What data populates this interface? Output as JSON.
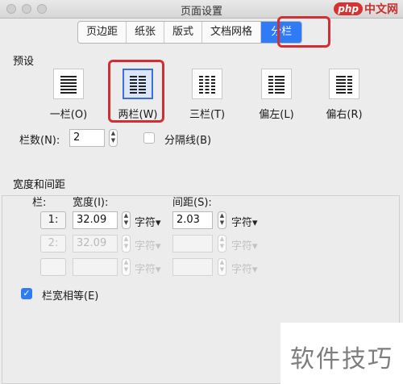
{
  "window": {
    "title": "页面设置"
  },
  "watermark": {
    "logo": "php",
    "text": "中文网",
    "bottom_text": "软件技巧"
  },
  "tabs": [
    {
      "label": "页边距"
    },
    {
      "label": "纸张"
    },
    {
      "label": "版式"
    },
    {
      "label": "文档网格"
    },
    {
      "label": "分栏",
      "active": true
    }
  ],
  "presets": {
    "heading": "预设",
    "items": [
      {
        "label": "一栏(O)",
        "icon": "one-column-icon"
      },
      {
        "label": "两栏(W)",
        "icon": "two-columns-icon",
        "selected": true
      },
      {
        "label": "三栏(T)",
        "icon": "three-columns-icon"
      },
      {
        "label": "偏左(L)",
        "icon": "left-column-icon"
      },
      {
        "label": "偏右(R)",
        "icon": "right-column-icon"
      }
    ]
  },
  "columns": {
    "label": "栏数(N):",
    "value": "2",
    "divider_label": "分隔线(B)",
    "divider_checked": false
  },
  "width_spacing": {
    "heading": "宽度和间距",
    "col_header": "栏:",
    "width_header": "宽度(I):",
    "spacing_header": "间距(S):",
    "rows": [
      {
        "col": "1:",
        "width": "32.09",
        "width_unit": "字符",
        "spacing": "2.03",
        "spacing_unit": "字符",
        "enabled": true
      },
      {
        "col": "2:",
        "width": "32.09",
        "width_unit": "字符",
        "spacing": "",
        "spacing_unit": "字符",
        "enabled": false
      },
      {
        "col": "",
        "width": "",
        "width_unit": "字符",
        "spacing": "",
        "spacing_unit": "字符",
        "enabled": false
      }
    ],
    "equal_width_label": "栏宽相等(E)",
    "equal_width_checked": true
  },
  "colors": {
    "accent": "#2f7bf6",
    "highlight": "#d12f34"
  }
}
